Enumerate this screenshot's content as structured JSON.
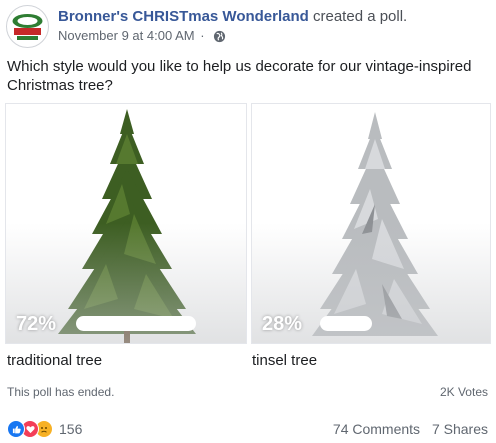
{
  "post": {
    "page_name": "Bronner's CHRISTmas Wonderland",
    "action": "created a poll.",
    "timestamp": "November 9 at 4:00 AM",
    "separator": "·",
    "privacy_icon": "globe-icon",
    "question": "Which style would you like to help us decorate for our vintage-inspired Christmas tree?"
  },
  "poll": {
    "options": [
      {
        "label": "traditional tree",
        "percent_text": "72%",
        "percent": 72,
        "image": "green-christmas-tree"
      },
      {
        "label": "tinsel tree",
        "percent_text": "28%",
        "percent": 28,
        "image": "silver-tinsel-tree"
      }
    ],
    "status": "This poll has ended.",
    "votes": "2K Votes"
  },
  "engagement": {
    "reaction_icons": [
      "like-icon",
      "love-icon",
      "sad-icon"
    ],
    "reaction_count": "156",
    "comments": "74 Comments",
    "shares": "7 Shares"
  },
  "colors": {
    "link": "#385898",
    "meta": "#606770",
    "like": "#1877f2",
    "love": "#f33e58",
    "sad": "#f7b125",
    "tree_green": "#3d5e22",
    "tree_silver": "#b9bcbf"
  }
}
